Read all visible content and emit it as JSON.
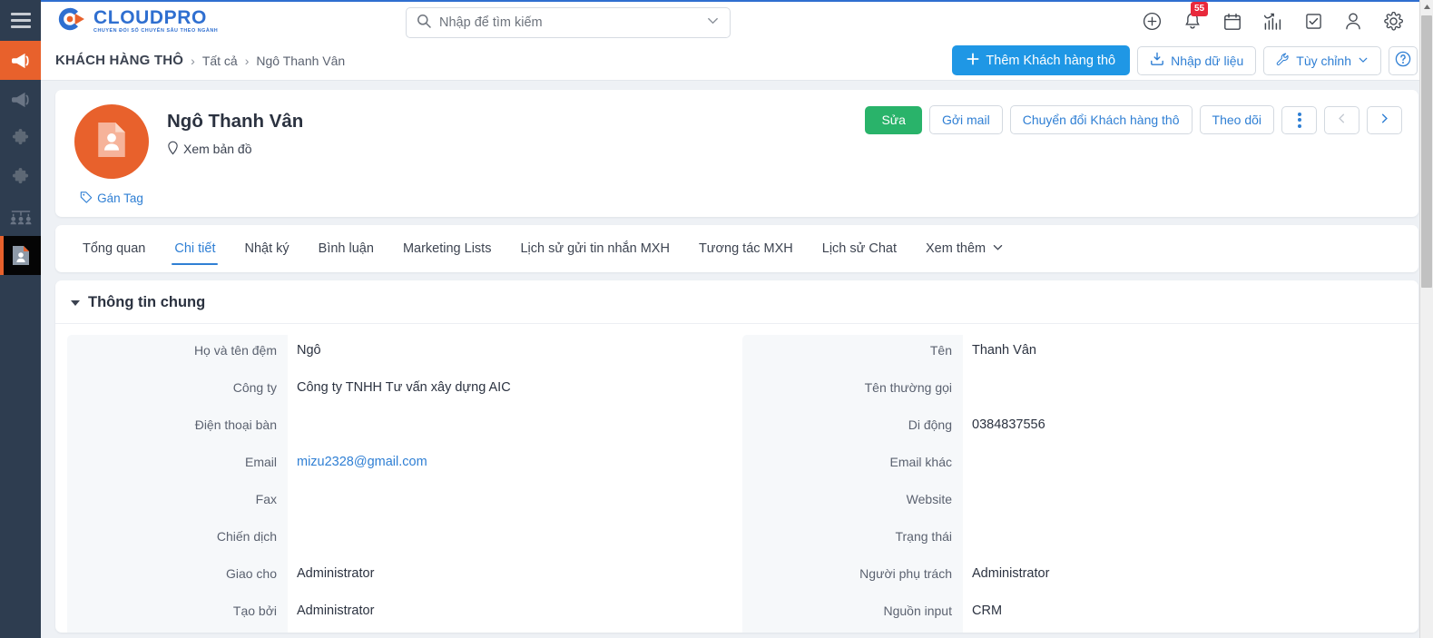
{
  "brand": {
    "logo_name": "CLOUDPRO",
    "logo_tagline": "CHUYỂN ĐỔI SỐ CHUYÊN SÂU THEO NGÀNH",
    "accent_blue": "#2f6fd0",
    "accent_orange": "#e8612c",
    "link_blue": "#2f7fd4",
    "green": "#29b36a",
    "badge_red": "#e8293c",
    "rail_bg": "#2e3d50"
  },
  "search": {
    "placeholder": "Nhập để tìm kiếm",
    "value": "",
    "icon": "search-icon",
    "chevron": "chevron-down-icon"
  },
  "topbar": {
    "icons": [
      {
        "name": "plus-circle-icon",
        "label": ""
      },
      {
        "name": "bell-icon",
        "label": "",
        "badge": "55"
      },
      {
        "name": "calendar-icon",
        "label": ""
      },
      {
        "name": "chart-icon",
        "label": ""
      },
      {
        "name": "task-check-icon",
        "label": ""
      },
      {
        "name": "user-icon",
        "label": ""
      },
      {
        "name": "gear-icon",
        "label": ""
      }
    ]
  },
  "sidebar": {
    "menu_icon": "hamburger-icon",
    "items": [
      {
        "name": "megaphone-active-icon",
        "label": "",
        "state": "active-orange"
      },
      {
        "name": "megaphone-icon",
        "label": "",
        "state": "normal"
      },
      {
        "name": "puzzle-piece-icon",
        "label": "",
        "state": "normal"
      },
      {
        "name": "puzzle-piece-icon-2",
        "label": "",
        "state": "normal"
      },
      {
        "name": "team-group-icon",
        "label": "",
        "state": "normal"
      },
      {
        "name": "contact-card-icon",
        "label": "",
        "state": "active-dark"
      }
    ]
  },
  "breadcrumb": {
    "module": "KHÁCH HÀNG THÔ",
    "separator": "›",
    "parent": "Tất cả",
    "current": "Ngô Thanh Vân"
  },
  "page_actions": {
    "add_label": "Thêm Khách hàng thô",
    "add_icon": "plus-icon",
    "import_label": "Nhập dữ liệu",
    "import_icon": "import-download-icon",
    "customize_label": "Tùy chỉnh",
    "customize_icon": "wrench-icon",
    "customize_chevron": "chevron-down-icon",
    "help_icon": "help-question-icon"
  },
  "record": {
    "avatar_icon": "contact-card-avatar-icon",
    "name": "Ngô Thanh Vân",
    "map_link": "Xem bản đồ",
    "map_icon": "map-pin-icon",
    "tag_link": "Gán Tag",
    "tag_icon": "tag-icon",
    "actions": {
      "edit": "Sửa",
      "send_mail": "Gởi mail",
      "convert": "Chuyển đổi Khách hàng thô",
      "follow": "Theo dõi",
      "more_icon": "vertical-dots-icon",
      "prev_icon": "chevron-left-icon",
      "next_icon": "chevron-right-icon"
    }
  },
  "tabs": [
    {
      "label": "Tổng quan",
      "active": false
    },
    {
      "label": "Chi tiết",
      "active": true
    },
    {
      "label": "Nhật ký",
      "active": false
    },
    {
      "label": "Bình luận",
      "active": false
    },
    {
      "label": "Marketing Lists",
      "active": false
    },
    {
      "label": "Lịch sử gửi tin nhắn MXH",
      "active": false
    },
    {
      "label": "Tương tác MXH",
      "active": false
    },
    {
      "label": "Lịch sử Chat",
      "active": false
    },
    {
      "label": "Xem thêm",
      "active": false,
      "chevron": "chevron-down-icon"
    }
  ],
  "detail": {
    "section_title": "Thông tin chung",
    "collapse_icon": "caret-down-icon",
    "left_fields": [
      {
        "label": "Họ và tên đệm",
        "value": "Ngô",
        "type": "text"
      },
      {
        "label": "Công ty",
        "value": "Công ty TNHH Tư vấn xây dựng AIC",
        "type": "text"
      },
      {
        "label": "Điện thoại bàn",
        "value": "",
        "type": "text"
      },
      {
        "label": "Email",
        "value": "mizu2328@gmail.com",
        "type": "link"
      },
      {
        "label": "Fax",
        "value": "",
        "type": "text"
      },
      {
        "label": "Chiến dịch",
        "value": "",
        "type": "text"
      },
      {
        "label": "Giao cho",
        "value": "Administrator",
        "type": "text"
      },
      {
        "label": "Tạo bởi",
        "value": "Administrator",
        "type": "text"
      }
    ],
    "right_fields": [
      {
        "label": "Tên",
        "value": "Thanh Vân",
        "type": "text"
      },
      {
        "label": "Tên thường gọi",
        "value": "",
        "type": "text"
      },
      {
        "label": "Di động",
        "value": "0384837556",
        "type": "text"
      },
      {
        "label": "Email khác",
        "value": "",
        "type": "text"
      },
      {
        "label": "Website",
        "value": "",
        "type": "text"
      },
      {
        "label": "Trạng thái",
        "value": "",
        "type": "text"
      },
      {
        "label": "Người phụ trách",
        "value": "Administrator",
        "type": "text"
      },
      {
        "label": "Nguồn input",
        "value": "CRM",
        "type": "text"
      }
    ]
  }
}
